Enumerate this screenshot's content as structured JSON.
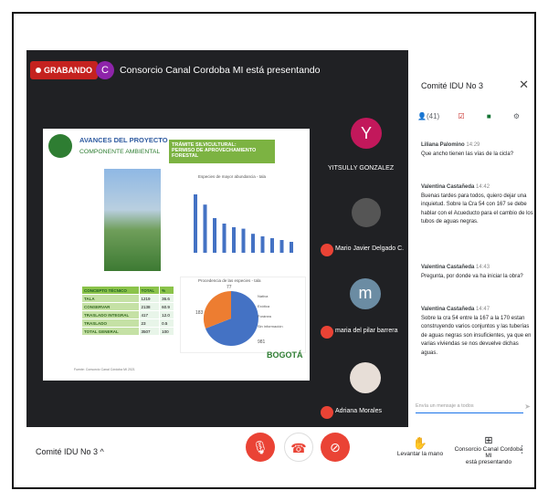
{
  "meet": {
    "recording_label": "GRABANDO",
    "presenter_initial": "C",
    "presenter_text": "Consorcio Canal Cordoba MI está presentando",
    "meeting_name": "Comité IDU No 3",
    "participant_count": "(41)"
  },
  "slide": {
    "title": "AVANCES DEL PROYECTO",
    "subtitle": "COMPONENTE AMBIENTAL",
    "tramite_line1": "TRÁMITE SILVICULTURAL:",
    "tramite_line2": "PERMISO DE APROVECHAMIENTO FORESTAL",
    "bar_chart_title": "Especies de mayor abundancia - tala",
    "pie_chart_title": "Procedencia de las especies - tala",
    "pie_labels": {
      "a": "77",
      "b": "183",
      "c": "981"
    },
    "legend": [
      "Nativa",
      "Exótica",
      "Foránea",
      "Sin información"
    ],
    "bogota": "BOGOTÁ",
    "footnote": "Fuente: Consorcio Canal Córdoba MI 2021",
    "table": {
      "headers": [
        "CONCEPTO TÉCNICO",
        "TOTAL",
        "%"
      ],
      "rows": [
        [
          "TALA",
          "1219",
          "36.6"
        ],
        [
          "CONSERVAR",
          "2138",
          "60.9"
        ],
        [
          "TRASLADO INTEGRAL",
          "417",
          "12.0"
        ],
        [
          "TRASLADO",
          "23",
          "0.5"
        ],
        [
          "TOTAL GENERAL",
          "3507",
          "100"
        ]
      ]
    },
    "bar_values": [
      160,
      132,
      95,
      80,
      70,
      66,
      52,
      45,
      40,
      35,
      30
    ]
  },
  "participants": [
    {
      "initial": "Y",
      "name": "YITSULLY GONZALEZ",
      "color": "#c2185b"
    },
    {
      "initial": "",
      "name": "Mario Javier Delgado C.",
      "color": "#555"
    },
    {
      "initial": "m",
      "name": "maria del pilar barrera",
      "color": "#6b8ca3"
    },
    {
      "initial": "",
      "name": "Adriana Morales",
      "color": "#e7ded7"
    }
  ],
  "chat": {
    "messages": [
      {
        "name": "Liliana Palomino",
        "time": "14:29",
        "text": "Que ancho tienen las vías de la cicla?"
      },
      {
        "name": "Valentina Castañeda",
        "time": "14:42",
        "text": "Buenas tardes para todos, quiero dejar una inquietud. Sobre la Cra 54 con 167 se debe hablar con el Acueducto para el cambio de los tubos de aguas negras."
      },
      {
        "name": "Valentina Castañeda",
        "time": "14:43",
        "text": "Pregunta, por donde va ha iniciar la obra?"
      },
      {
        "name": "Valentina Castañeda",
        "time": "14:47",
        "text": "Sobre la cra 54 entre la 167 a la 170 estan construyendo varios conjuntos y las tuberías de aguas negras son insuficientes, ya que en varias viviendas se nos devuelve dichas aguas."
      }
    ],
    "compose_placeholder": "Envía un mensaje a todos"
  },
  "controls": {
    "raise_hand": "Levantar la mano",
    "presenting_line1": "Consorcio Canal Cordoba MI",
    "presenting_line2": "está presentando"
  }
}
